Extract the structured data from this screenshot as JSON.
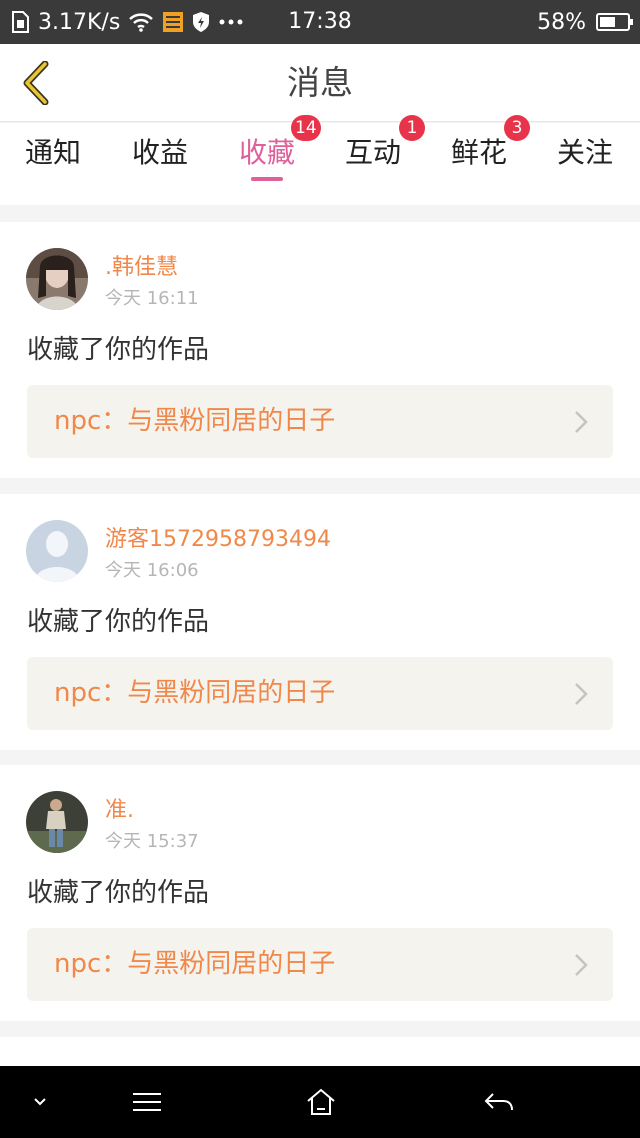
{
  "status_bar": {
    "speed": "3.17K/s",
    "time": "17:38",
    "battery_percent": "58%",
    "battery_level": 0.58,
    "icons": [
      "sim-icon",
      "wifi-icon",
      "storage-icon",
      "shield-icon",
      "more-dots-icon"
    ]
  },
  "header": {
    "title": "消息",
    "back_icon": "chevron-left-icon",
    "back_color": "#c9a61b"
  },
  "tabs": [
    {
      "label": "通知",
      "badge": "",
      "active": false
    },
    {
      "label": "收益",
      "badge": "",
      "active": false
    },
    {
      "label": "收藏",
      "badge": "14",
      "active": true
    },
    {
      "label": "互动",
      "badge": "1",
      "active": false
    },
    {
      "label": "鲜花",
      "badge": "3",
      "active": false
    },
    {
      "label": "关注",
      "badge": "",
      "active": false
    }
  ],
  "colors": {
    "accent": "#e0609a",
    "name": "#f0884a",
    "badge": "#e8344a"
  },
  "messages": [
    {
      "user": ".韩佳慧",
      "time": "今天 16:11",
      "text": "收藏了你的作品",
      "work": "npc：与黑粉同居的日子",
      "avatar": "photo-avatar-girl"
    },
    {
      "user": "游客1572958793494",
      "time": "今天 16:06",
      "text": "收藏了你的作品",
      "work": "npc：与黑粉同居的日子",
      "avatar": "default-avatar"
    },
    {
      "user": "准.",
      "time": "今天 15:37",
      "text": "收藏了你的作品",
      "work": "npc：与黑粉同居的日子",
      "avatar": "photo-avatar-person"
    }
  ],
  "nav_bar": {
    "icons": [
      "chevron-down-icon",
      "menu-icon",
      "home-icon",
      "back-arrow-icon"
    ]
  }
}
